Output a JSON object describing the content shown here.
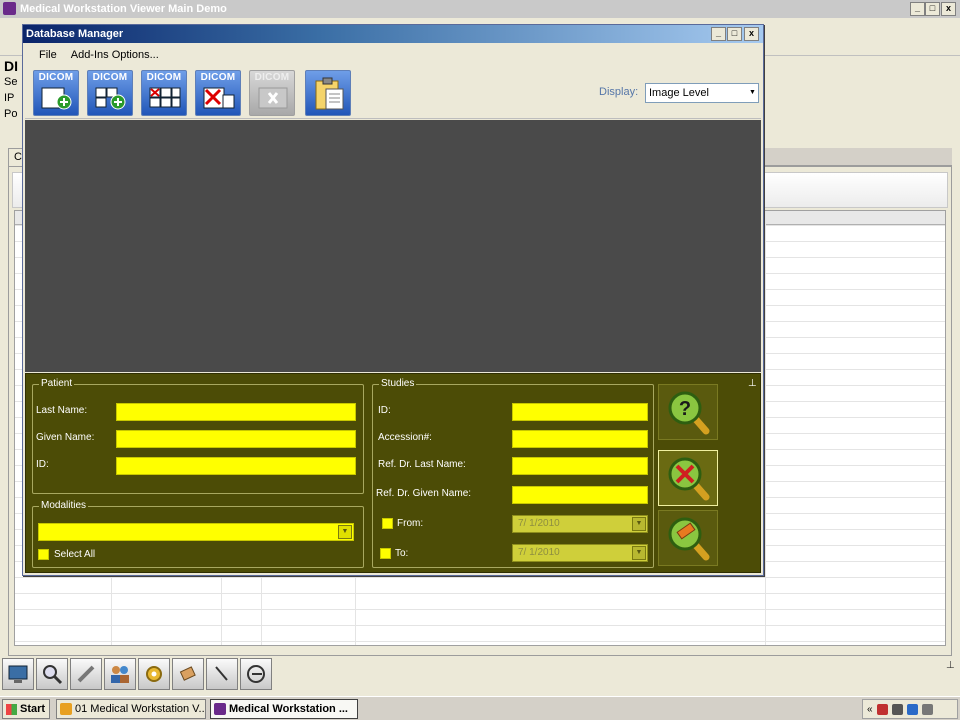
{
  "main_window": {
    "title": "Medical Workstation Viewer Main Demo",
    "left_info": {
      "title_fragment": "DI",
      "line1": "Se",
      "line2": "IP",
      "line3": "Po"
    },
    "tab_label": "C"
  },
  "dialog": {
    "title": "Database Manager",
    "menu": [
      "File",
      "Add-Ins Options..."
    ],
    "toolbar_buttons": [
      {
        "label": "DICOM",
        "icon": "dicom-add-icon",
        "enabled": true
      },
      {
        "label": "DICOM",
        "icon": "dicom-import-icon",
        "enabled": true
      },
      {
        "label": "DICOM",
        "icon": "dicom-delete-icon",
        "enabled": true
      },
      {
        "label": "DICOM",
        "icon": "dicom-remove-icon",
        "enabled": true
      },
      {
        "label": "DICOM",
        "icon": "dicom-close-icon",
        "enabled": false
      },
      {
        "label": "",
        "icon": "clipboard-icon",
        "enabled": true
      }
    ],
    "display_label": "Display:",
    "display_value": "Image Level",
    "search": {
      "patient": {
        "title": "Patient",
        "last_name_label": "Last Name:",
        "given_name_label": "Given Name:",
        "id_label": "ID:"
      },
      "modalities": {
        "title": "Modalities",
        "select_all_label": "Select All"
      },
      "studies": {
        "title": "Studies",
        "id_label": "ID:",
        "accession_label": "Accession#:",
        "ref_last_label": "Ref. Dr. Last Name:",
        "ref_given_label": "Ref. Dr. Given Name:",
        "from_label": "From:",
        "to_label": "To:",
        "from_date": "7/ 1/2010",
        "to_date": "7/ 1/2010"
      }
    }
  },
  "taskbar": {
    "start_label": "Start",
    "tasks": [
      {
        "label": "01 Medical Workstation V...",
        "active": false
      },
      {
        "label": "Medical Workstation ...",
        "active": true
      }
    ],
    "tray_chevron": "«"
  },
  "colors": {
    "search_panel_bg": "#4c4c06",
    "field_yellow": "#ffff00",
    "viewer_bg": "#4a4a4a",
    "title_blue": "#0a246a"
  }
}
